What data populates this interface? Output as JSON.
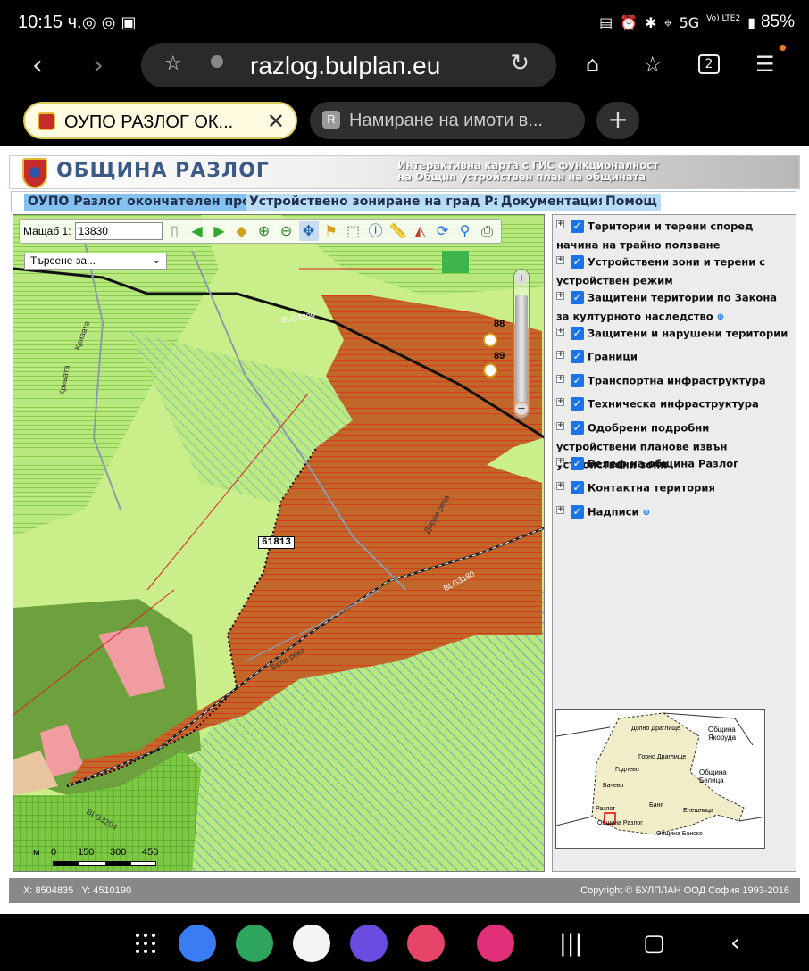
{
  "status": {
    "time": "10:15 ч.",
    "battery": "85%",
    "network": "5G",
    "volte": "Vo) LTE2"
  },
  "browser": {
    "url": "razlog.bulplan.eu",
    "tab_count": "2",
    "tabs": [
      {
        "title": "ОУПО РАЗЛОГ ОК...",
        "favicon": "razlog-crest"
      },
      {
        "title": "Намиране на имоти в...",
        "favicon": "R"
      }
    ]
  },
  "site": {
    "title": "ОБЩИНА РАЗЛОГ",
    "subtitle_line1": "Интерактивна карта с ГИС функционалност",
    "subtitle_line2": "на Общия устройствен план на общината",
    "menu": [
      "ОУПО Разлог окончателен проект",
      "Устройствено зониране на град Разлог",
      "Документация",
      "Помощ"
    ]
  },
  "map": {
    "scale_label": "Мащаб 1:",
    "scale_value": "13830",
    "search_placeholder": "Търсене за...",
    "parcel_label": "61813",
    "poi_labels": [
      "88",
      "89"
    ],
    "road_labels": [
      "BLG3209",
      "BLG3180",
      "BLG3204"
    ],
    "river_labels": [
      "Кривата",
      "Кривата",
      "Дорри река",
      "Бяла река"
    ],
    "scale_bar": {
      "unit": "м",
      "ticks": [
        "0",
        "150",
        "300",
        "450"
      ]
    },
    "zone_colors": {
      "orange": "#c2672a",
      "light_green": "#b9e87f",
      "green": "#7cc842",
      "dark_green": "#6ca13e",
      "pink": "#f19ca0",
      "blue_hatch": "#3b8ed8"
    }
  },
  "layers": [
    {
      "label": "Територии и терени според начина на трайно ползване",
      "zoom": false
    },
    {
      "label": "Устройствени зони и терени с устройствен режим",
      "zoom": false
    },
    {
      "label": "Защитени територии по Закона за културното наследство",
      "zoom": true
    },
    {
      "label": "Защитени и нарушени територии",
      "zoom": false
    },
    {
      "label": "Граници",
      "zoom": false
    },
    {
      "label": "Транспортна инфраструктура",
      "zoom": false
    },
    {
      "label": "Техническа инфраструктура",
      "zoom": false
    },
    {
      "label": "Одобрени подробни устройствени планове извън устройствени зони",
      "zoom": false
    },
    {
      "label": "Релеф на община Разлог",
      "zoom": false
    },
    {
      "label": "Контактна територия",
      "zoom": false
    },
    {
      "label": "Надписи",
      "zoom": true
    }
  ],
  "overview": {
    "labels": [
      "Община Якоруда",
      "Долно Драглище",
      "Горно Драглище",
      "Годлево",
      "Бачево",
      "Община Белица",
      "Баня",
      "Елешница",
      "Разлог",
      "Община Разлог",
      "Община Банско"
    ]
  },
  "footer": {
    "x": "X: 8504835",
    "y": "Y: 4510190",
    "copyright": "Copyright © БУЛПЛАН ООД София 1993-2016"
  }
}
